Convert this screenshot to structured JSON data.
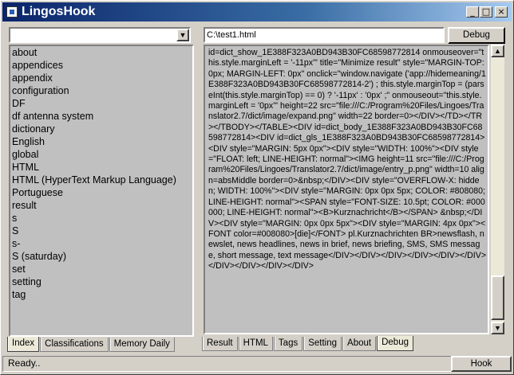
{
  "app": {
    "title": "LingosHook"
  },
  "window_controls": {
    "minimize": "_",
    "maximize": "□",
    "close": "×"
  },
  "left": {
    "combo": {
      "value": "",
      "arrow": "▼"
    },
    "list": [
      "about",
      "appendices",
      "appendix",
      "configuration",
      "DF",
      "df antenna system",
      "dictionary",
      "English",
      "global",
      "HTML",
      "HTML (HyperText Markup Language)",
      "Portuguese",
      "result",
      "s",
      "S",
      "s-",
      "S (saturday)",
      "set",
      "setting",
      "tag"
    ],
    "tabs": [
      {
        "label": "Index",
        "active": true
      },
      {
        "label": "Classifications",
        "active": false
      },
      {
        "label": "Memory Daily",
        "active": false
      }
    ]
  },
  "right": {
    "path": "C:\\test1.html",
    "debug_button": "Debug",
    "content": "id=dict_show_1E388F323A0BD943B30FC68598772814 onmouseover=\"this.style.marginLeft = '-11px'\" title=\"Minimize result\" style=\"MARGIN-TOP: 0px; MARGIN-LEFT: 0px\" onclick=\"window.navigate ('app://hidemeaning/1E388F323A0BD943B30FC68598772814-2') ; this.style.marginTop = (parseInt(this.style.marginTop) == 0) ? '-11px' : '0px' ;\" onmouseout=\"this.style.marginLeft = '0px'\" height=22 src=\"file:///C:/Program%20Files/Lingoes/Translator2.7/dict/image/expand.png\" width=22 border=0></DIV></TD></TR></TBODY></TABLE><DIV id=dict_body_1E388F323A0BD943B30FC68598772814><DIV id=dict_gls_1E388F323A0BD943B30FC68598772814><DIV style=\"MARGIN: 5px 0px\"><DIV style=\"WIDTH: 100%\"><DIV style=\"FLOAT: left; LINE-HEIGHT: normal\"><IMG height=11 src=\"file:///C:/Program%20Files/Lingoes/Translator2.7/dict/image/entry_p.png\" width=10 align=absMiddle border=0>&nbsp;</DIV><DIV style=\"OVERFLOW-X: hidden; WIDTH: 100%\"><DIV style=\"MARGIN: 0px 0px 5px; COLOR: #808080; LINE-HEIGHT: normal\"><SPAN style=\"FONT-SIZE: 10.5pt; COLOR: #000000; LINE-HEIGHT: normal\"><B>Kurznachricht</B></SPAN> &nbsp;</DIV><DIV style=\"MARGIN: 0px 0px 5px\"><DIV style=\"MARGIN: 4px 0px\"><FONT color=#008080>[die]</FONT> pl.Kurznachrichten BR>newsflash, newslet, news headlines, news in brief, news briefing, SMS, SMS message, short message, text message</DIV></DIV></DIV></DIV></DIV></DIV></DIV></DIV></DIV></DIV>",
    "tabs": [
      {
        "label": "Result",
        "active": false
      },
      {
        "label": "HTML",
        "active": false
      },
      {
        "label": "Tags",
        "active": false
      },
      {
        "label": "Setting",
        "active": false
      },
      {
        "label": "About",
        "active": false
      },
      {
        "label": "Debug",
        "active": true
      }
    ],
    "scroll": {
      "up": "▲",
      "down": "▼"
    }
  },
  "status": {
    "text": "Ready..",
    "hook_button": "Hook"
  }
}
